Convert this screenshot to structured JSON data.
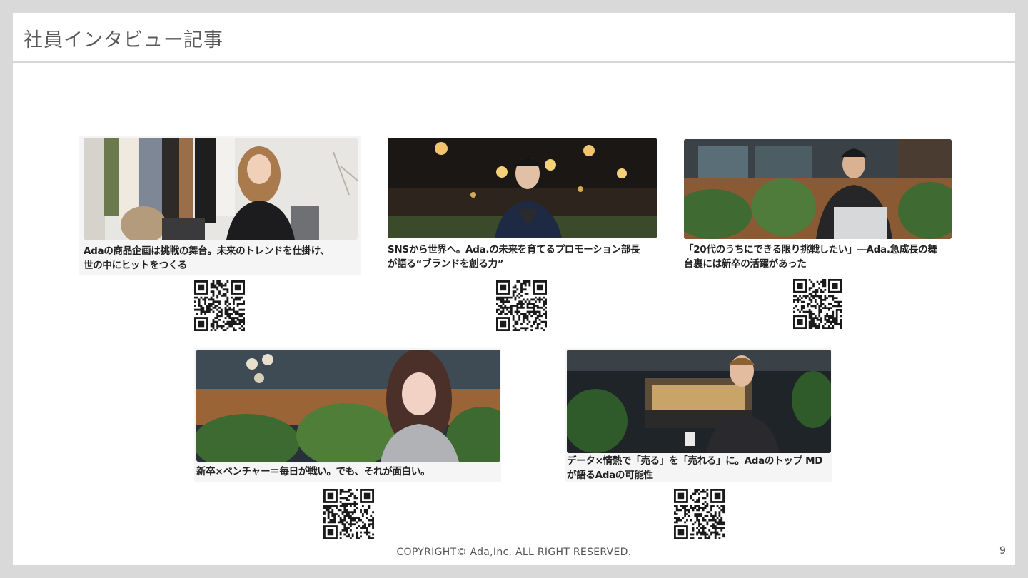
{
  "title": "社員インタビュー記事",
  "articles": [
    {
      "caption_line1": "Adaの商品企画は挑戦の舞台。未来のトレンドを仕掛け、",
      "caption_line2": "世の中にヒットをつくる",
      "photo": "woman-with-laptop-photo"
    },
    {
      "caption_line1": "SNSから世界へ。Ada.の未来を育てるプロモーション部長",
      "caption_line2": "が語る“ブランドを創る力”",
      "photo": "man-in-cafe-photo"
    },
    {
      "caption_line1": "「20代のうちにできる限り挑戦したい」―Ada.急成長の舞",
      "caption_line2": "台裏には新卒の活躍があった",
      "photo": "man-with-laptop-photo"
    },
    {
      "caption_line1": "新卒×ベンチャー＝毎日が戦い。でも、それが面白い。",
      "caption_line2": "",
      "photo": "woman-with-plants-photo"
    },
    {
      "caption_line1": "データ×情熱で「売る」を「売れる」に。Adaのトップ MD",
      "caption_line2": "が語るAdaの可能性",
      "photo": "man-in-store-photo"
    }
  ],
  "footer": "COPYRIGHT© Ada,Inc. ALL RIGHT RESERVED.",
  "page_number": "9"
}
